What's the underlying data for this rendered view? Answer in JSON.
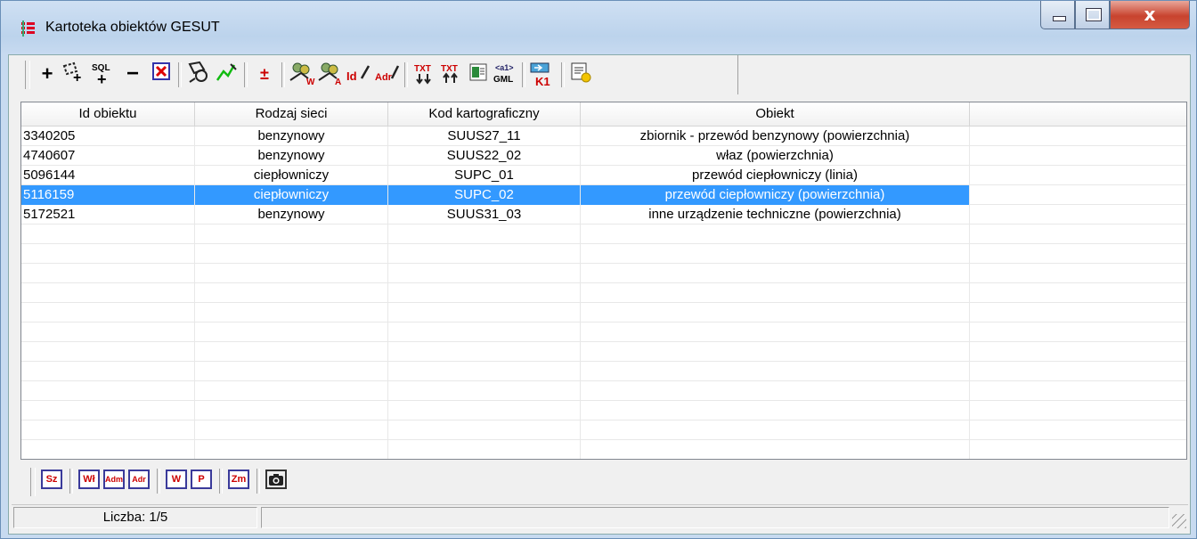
{
  "window": {
    "title": "Kartoteka obiektów GESUT",
    "controls": {
      "minimize": "_",
      "maximize": "□",
      "close": "x"
    }
  },
  "toolbar": {
    "buttons": [
      {
        "icon": "add-icon",
        "label": "+"
      },
      {
        "icon": "add-by-polygon-icon",
        "label": ""
      },
      {
        "icon": "sql-add-icon",
        "label": "SQL"
      },
      {
        "icon": "remove-icon",
        "label": "−"
      },
      {
        "icon": "clear-icon",
        "label": "⊠"
      },
      {
        "icon": "select-area-icon",
        "label": ""
      },
      {
        "icon": "draw-line-icon",
        "label": ""
      },
      {
        "icon": "plus-minus-icon",
        "label": "±"
      },
      {
        "icon": "users-w-icon",
        "label": "W"
      },
      {
        "icon": "users-a-icon",
        "label": "A"
      },
      {
        "icon": "edit-id-icon",
        "label": "Id"
      },
      {
        "icon": "edit-adr-icon",
        "label": "Adr"
      },
      {
        "icon": "txt-import-icon",
        "label": "TXT"
      },
      {
        "icon": "txt-export-icon",
        "label": "TXT"
      },
      {
        "icon": "excel-export-icon",
        "label": ""
      },
      {
        "icon": "gml-export-icon",
        "label": "GML"
      },
      {
        "icon": "k1-icon",
        "label": "K1"
      },
      {
        "icon": "report-icon",
        "label": ""
      }
    ]
  },
  "table": {
    "columns": [
      "Id obiektu",
      "Rodzaj sieci",
      "Kod kartograficzny",
      "Obiekt",
      ""
    ],
    "rows": [
      [
        "3340205",
        "benzynowy",
        "SUUS27_11",
        "zbiornik - przewód benzynowy (powierzchnia)"
      ],
      [
        "4740607",
        "benzynowy",
        "SUUS22_02",
        "właz (powierzchnia)"
      ],
      [
        "5096144",
        "ciepłowniczy",
        "SUPC_01",
        "przewód ciepłowniczy (linia)"
      ],
      [
        "5116159",
        "ciepłowniczy",
        "SUPC_02",
        "przewód ciepłowniczy (powierzchnia)"
      ],
      [
        "5172521",
        "benzynowy",
        "SUUS31_03",
        "inne urządzenie techniczne (powierzchnia)"
      ]
    ],
    "selected_row_index": 3
  },
  "bottom_toolbar": {
    "buttons": [
      "Sz",
      "Wł",
      "Adm",
      "Adr",
      "W",
      "P",
      "Zm",
      "camera-icon"
    ]
  },
  "status": {
    "count_text": "Liczba: 1/5",
    "second_pane": ""
  },
  "colors": {
    "selection": "#3399ff",
    "title_gradient": "#bcd3ec"
  }
}
